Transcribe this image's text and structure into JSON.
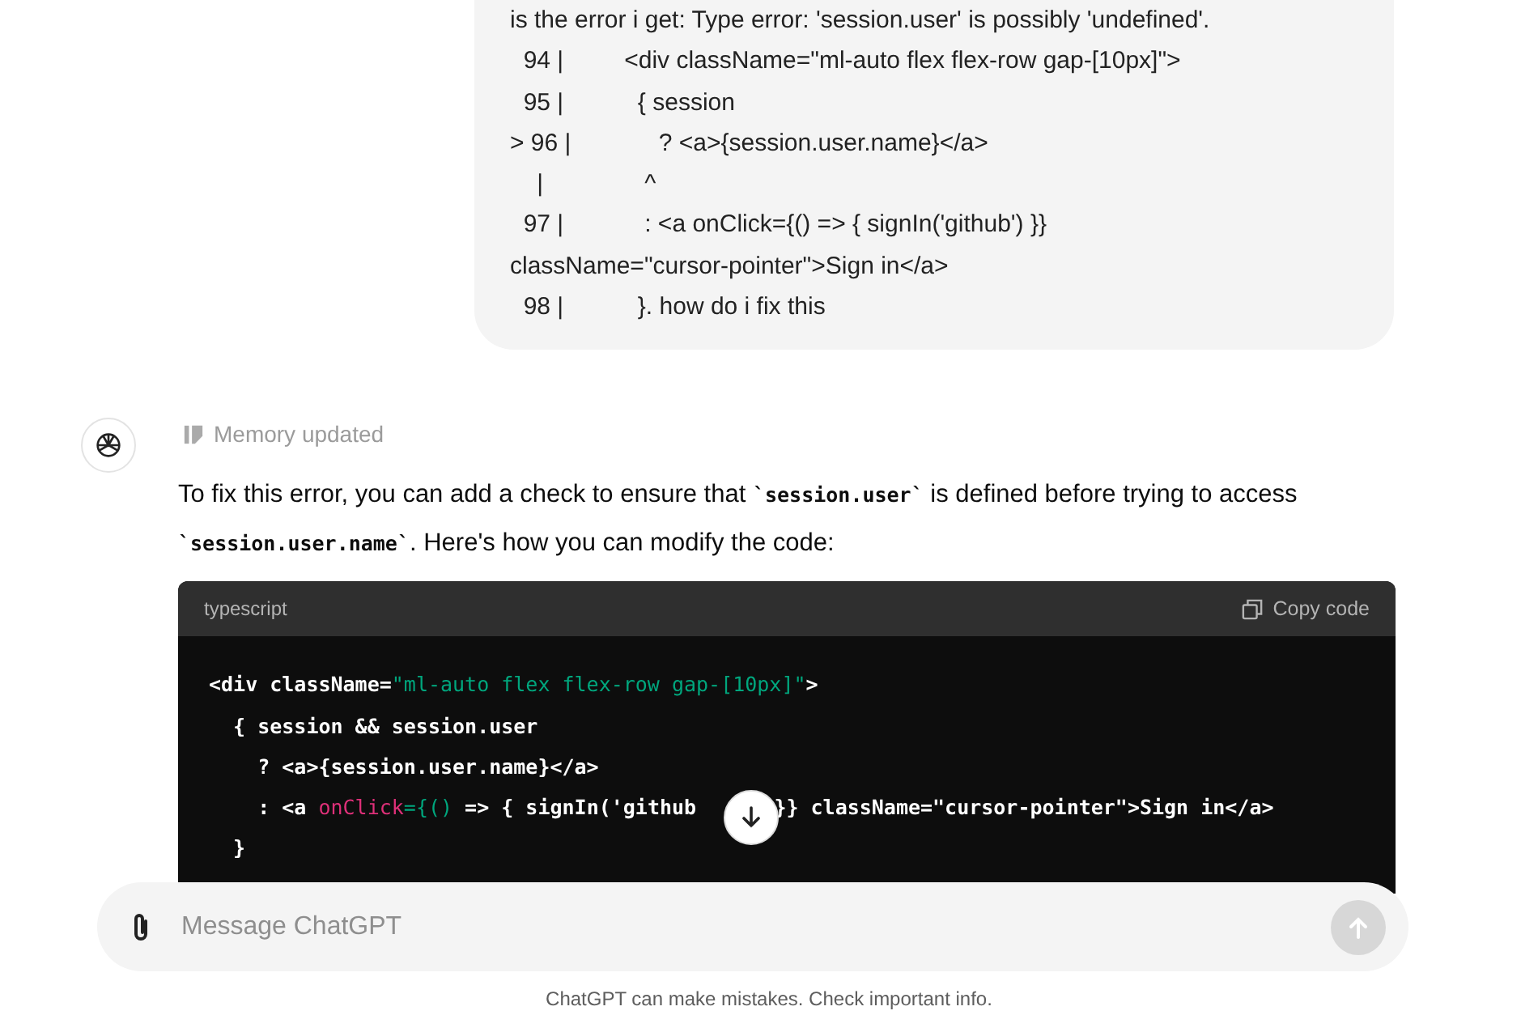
{
  "user_message": {
    "lines": [
      "is the error i get: Type error: 'session.user' is possibly 'undefined'.",
      "  94 |         <div className=\"ml-auto flex flex-row gap-[10px]\">",
      "  95 |           { session",
      "> 96 |             ? <a>{session.user.name}</a>",
      "    |               ^",
      "  97 |            : <a onClick={() => { signIn('github') }}",
      "className=\"cursor-pointer\">Sign in</a>",
      "  98 |           }. how do i fix this"
    ]
  },
  "assistant_message": {
    "memory_note": "Memory updated",
    "text": "To fix this error, you can add a check to ensure that **`session.user`** is defined before trying to access **`session.user.name`**. Here's how you can modify the code:",
    "code_block": {
      "language": "typescript",
      "copy_label": "Copy code",
      "lines": [
        [
          {
            "kind": "plain",
            "text": "<div className="
          },
          {
            "kind": "string",
            "text": "\"ml-auto flex flex-row gap-[10px]\""
          },
          {
            "kind": "plain",
            "text": ">"
          }
        ],
        [
          {
            "kind": "plain",
            "text": "  { session && session.user"
          }
        ],
        [
          {
            "kind": "plain",
            "text": "    ? <a>{session.user.name}</a>"
          }
        ],
        [
          {
            "kind": "plain",
            "text": "    : <a "
          },
          {
            "kind": "attr",
            "text": "onClick"
          },
          {
            "kind": "string",
            "text": "={()"
          },
          {
            "kind": "plain",
            "text": " => { signIn('github"
          },
          {
            "kind": "covered"
          },
          {
            "kind": "plain",
            "text": " }} className=\"cursor-pointer\">Sign in</a>"
          }
        ],
        [
          {
            "kind": "plain",
            "text": "  }"
          }
        ]
      ]
    }
  },
  "composer": {
    "placeholder": "Message ChatGPT",
    "send_disabled": true
  },
  "footer": "ChatGPT can make mistakes. Check important info."
}
